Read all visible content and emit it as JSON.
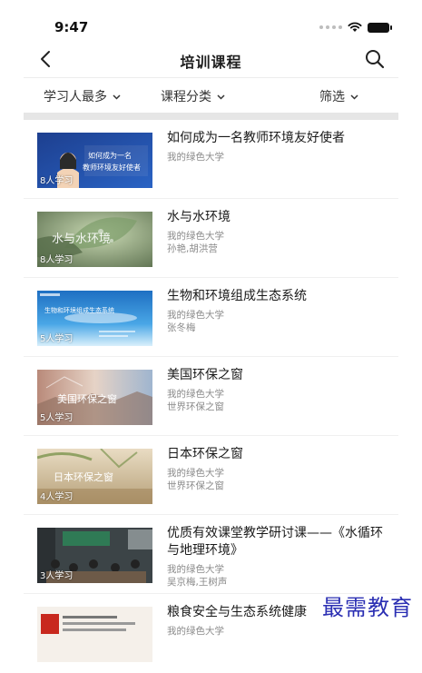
{
  "status": {
    "time": "9:47"
  },
  "nav": {
    "title": "培训课程"
  },
  "filters": {
    "sort": "学习人最多",
    "category": "课程分类",
    "filter": "筛选"
  },
  "courses": [
    {
      "title": "如何成为一名教师环境友好使者",
      "org": "我的绿色大学",
      "author": "",
      "count": "8人学习",
      "thumb_text_1": "如何成为一名",
      "thumb_text_2": "教师环境友好使者"
    },
    {
      "title": "水与水环境",
      "org": "我的绿色大学",
      "author": "孙艳,胡洪营",
      "count": "8人学习",
      "thumb_text_1": "水与水环境"
    },
    {
      "title": "生物和环境组成生态系统",
      "org": "我的绿色大学",
      "author": "张冬梅",
      "count": "5人学习",
      "thumb_text_1": "生物和环境组成生态系统"
    },
    {
      "title": "美国环保之窗",
      "org": "我的绿色大学",
      "author": "世界环保之窗",
      "count": "5人学习",
      "thumb_text_1": "美国环保之窗"
    },
    {
      "title": "日本环保之窗",
      "org": "我的绿色大学",
      "author": "世界环保之窗",
      "count": "4人学习",
      "thumb_text_1": "日本环保之窗"
    },
    {
      "title": "优质有效课堂教学研讨课——《水循环与地理环境》",
      "org": "我的绿色大学",
      "author": "吴京梅,王树声",
      "count": "3人学习"
    },
    {
      "title": "粮食安全与生态系统健康",
      "org": "我的绿色大学",
      "author": "",
      "count": ""
    }
  ],
  "watermark": "最需教育",
  "colors": {
    "divider": "#ececec",
    "section_bg": "#e6e6e6",
    "meta_text": "#8a8a8a",
    "watermark": "#2b2fb3"
  }
}
